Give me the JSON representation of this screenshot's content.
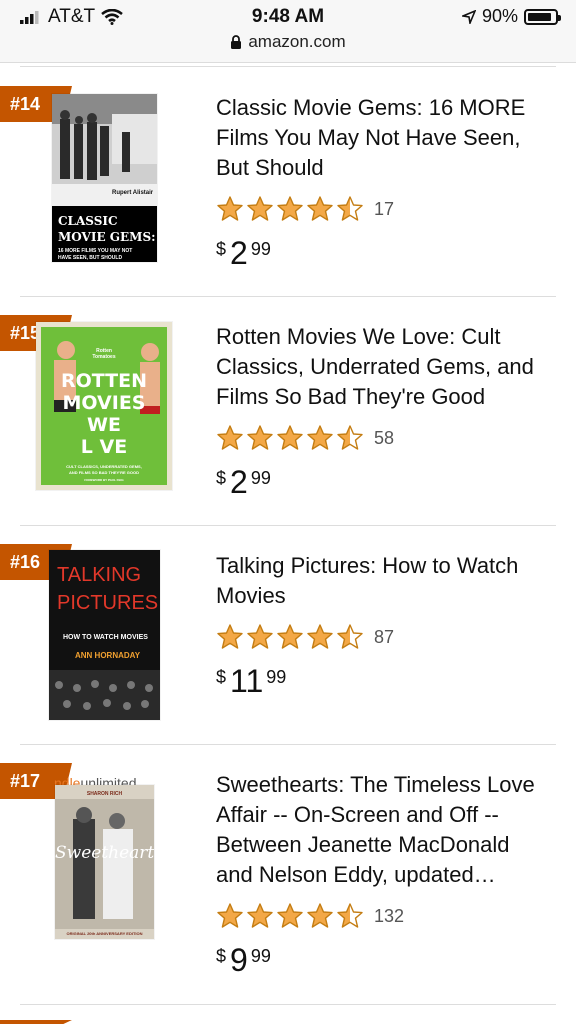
{
  "status": {
    "carrier": "AT&T",
    "time": "9:48 AM",
    "url": "amazon.com",
    "battery_pct": "90%",
    "battery_level": 0.9
  },
  "items": [
    {
      "rank": "#14",
      "title": "Classic Movie Gems: 16 MORE Films You May Not Have Seen, But Should",
      "rating": 4.5,
      "count": "17",
      "price_symbol": "$",
      "price_whole": "2",
      "price_frac": "99",
      "cover": {
        "author": "Rupert Alistair",
        "title_lines": [
          "CLASSIC",
          "MOVIE GEMS:"
        ],
        "subtitle_lines": [
          "16 MORE FILMS YOU MAY NOT",
          "HAVE SEEN, BUT SHOULD"
        ]
      }
    },
    {
      "rank": "#15",
      "title": "Rotten Movies We Love: Cult Classics, Underrated Gems, and Films So Bad They're Good",
      "rating": 4.5,
      "count": "58",
      "price_symbol": "$",
      "price_whole": "2",
      "price_frac": "99",
      "cover": {
        "top": "Rotten Tomatoes",
        "title_lines": [
          "ROTTEN",
          "MOVIES",
          "WE",
          "L VE"
        ],
        "subtitle_lines": [
          "CULT CLASSICS, UNDERRATED GEMS,",
          "AND FILMS SO BAD THEY'RE GOOD"
        ],
        "foreword": "FOREWORD BY PAUL FEIG"
      }
    },
    {
      "rank": "#16",
      "title": "Talking Pictures: How to Watch Movies",
      "rating": 4.5,
      "count": "87",
      "price_symbol": "$",
      "price_whole": "11",
      "price_frac": "99",
      "cover": {
        "title_lines": [
          "TALKING",
          "PICTURES"
        ],
        "subtitle": "HOW TO WATCH MOVIES",
        "author": "ANN HORNADAY"
      }
    },
    {
      "rank": "#17",
      "title": "Sweethearts: The Timeless Love Affair -- On-Screen and Off -- Between Jeanette MacDonald and Nelson Eddy, updated…",
      "rating": 4.5,
      "count": "132",
      "price_symbol": "$",
      "price_whole": "9",
      "price_frac": "99",
      "cover": {
        "brand_prefix": "ndle",
        "brand_suffix": "unlimited",
        "author": "SHARON RICH",
        "title": "Sweethearts",
        "edition": "ORIGINAL 20th ANNIVERSARY EDITION"
      }
    }
  ]
}
